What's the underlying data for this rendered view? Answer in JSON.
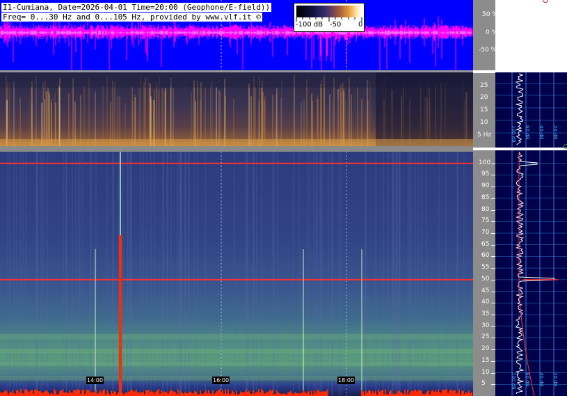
{
  "header": {
    "line1": "I1-Cumiana, Date=2026-04-01 Time=20:00 (Geophone/E-field))",
    "line2": "Freq= 0...30 Hz and 0...105 Hz, provided by www.vlf.it ©"
  },
  "colorbar": {
    "min_label": "-100 dB",
    "mid_label": "-50",
    "max_label": "0"
  },
  "waveform_axis": {
    "labels": [
      "50 %",
      "0 %",
      "-50 %"
    ]
  },
  "low_band_axis": {
    "labels": [
      "25",
      "20",
      "15",
      "10",
      "5 Hz"
    ]
  },
  "high_band_axis": {
    "labels": [
      "100",
      "95",
      "90",
      "85",
      "80",
      "75",
      "70",
      "65",
      "60",
      "55",
      "50",
      "45",
      "40",
      "35",
      "30",
      "25",
      "20",
      "15",
      "10",
      "5"
    ]
  },
  "time_markers": [
    "14:00",
    "16:00",
    "18:00"
  ],
  "spectrum_panel": {
    "upper_scale": [
      "100 dB",
      "60 dB",
      "40 dB",
      "20 dB"
    ],
    "lower_scale": [
      "100 dB",
      "60 dB",
      "40 dB",
      "20 dB"
    ]
  },
  "colors": {
    "waveform_bg": "#0000ff",
    "waveform_trace": "#ff00ff",
    "right_panel_bg": "#00004a",
    "grid_line": "#3fb4ff",
    "mains_line": "#ff2020"
  }
}
